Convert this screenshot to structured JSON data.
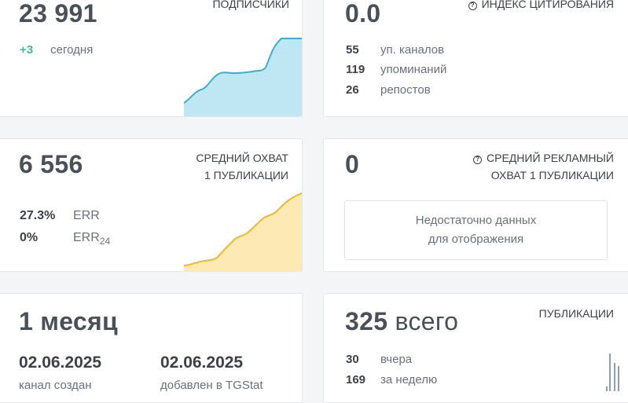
{
  "subscribers": {
    "value": "23 991",
    "label": "ПОДПИСЧИКИ",
    "delta": "+3",
    "delta_label": "сегодня",
    "colors": {
      "line": "#3aafcf",
      "fill": "#bfe6f3"
    }
  },
  "citation": {
    "value": "0.0",
    "label": "ИНДЕКС ЦИТИРОВАНИЯ",
    "icon": "info-icon",
    "rows": [
      {
        "num": "55",
        "text": "уп. каналов"
      },
      {
        "num": "119",
        "text": "упоминаний"
      },
      {
        "num": "26",
        "text": "репостов"
      }
    ]
  },
  "reach": {
    "value": "6 556",
    "label_line1": "СРЕДНИЙ ОХВАТ",
    "label_line2": "1 ПУБЛИКАЦИИ",
    "rows": [
      {
        "num": "27.3%",
        "text": "ERR"
      },
      {
        "num": "0%",
        "text": "ERR",
        "sub": "24"
      }
    ],
    "colors": {
      "line": "#f0b92a",
      "fill": "#fde9b3"
    }
  },
  "ad_reach": {
    "value": "0",
    "label_line1": "СРЕДНИЙ РЕКЛАМНЫЙ",
    "label_line2": "ОХВАТ 1 ПУБЛИКАЦИИ",
    "icon": "info-icon",
    "empty_line1": "Недостаточно данных",
    "empty_line2": "для отображения"
  },
  "age": {
    "value": "1 месяц",
    "created_date": "02.06.2025",
    "created_label": "канал создан",
    "added_date": "02.06.2025",
    "added_label": "добавлен в TGStat"
  },
  "posts": {
    "value": "325",
    "value_suffix": "всего",
    "label": "ПУБЛИКАЦИИ",
    "rows": [
      {
        "num": "30",
        "text": "вчера"
      },
      {
        "num": "169",
        "text": "за неделю"
      }
    ],
    "colors": {
      "bar": "#8f9fb3"
    }
  }
}
